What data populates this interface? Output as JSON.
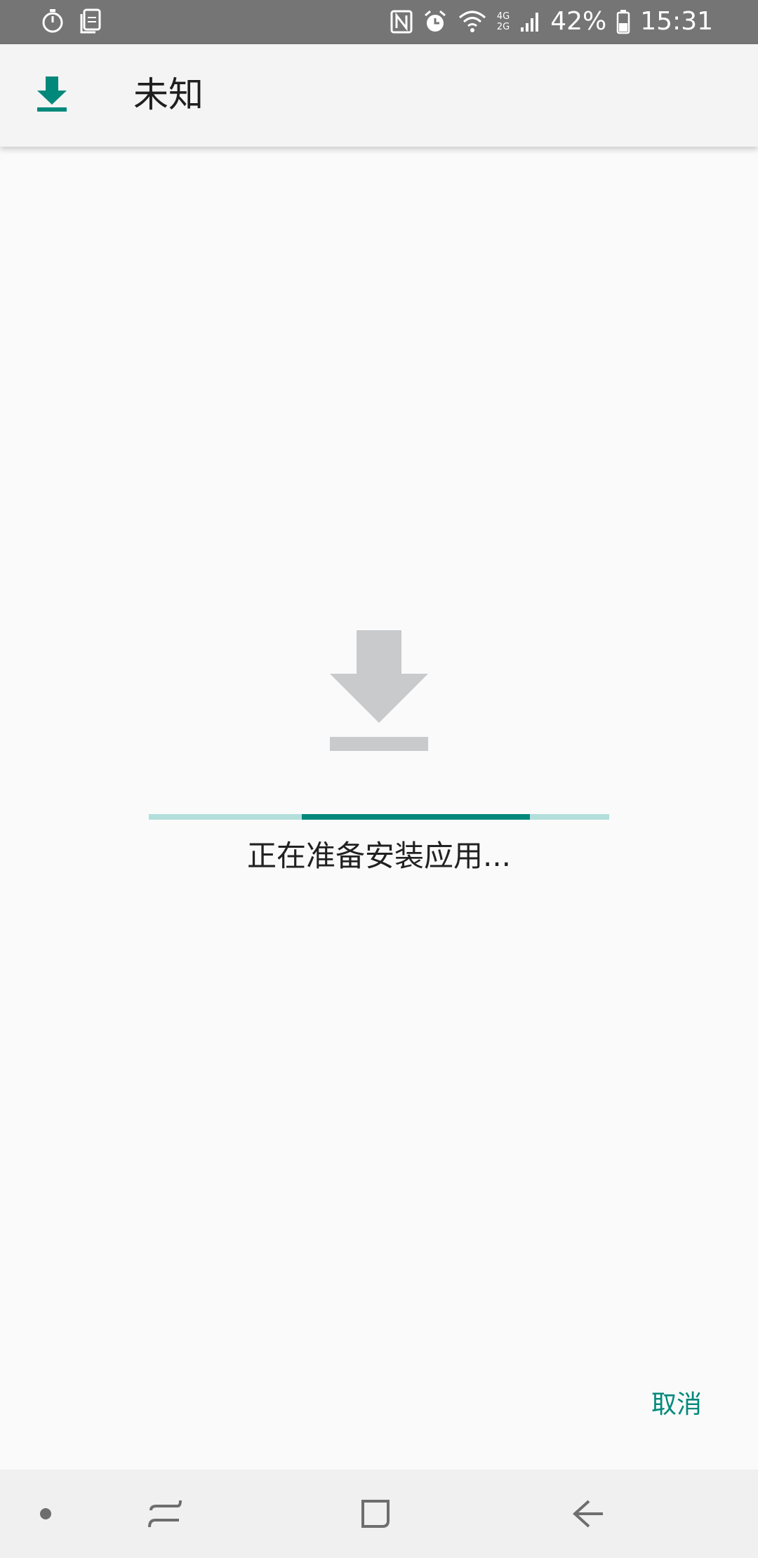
{
  "status_bar": {
    "battery": "42%",
    "time": "15:31",
    "network_labels": [
      "4G",
      "2G"
    ],
    "icons": [
      "stopwatch-icon",
      "clipboard-icon",
      "nfc-icon",
      "alarm-icon",
      "wifi-icon",
      "cell-signal-icon",
      "battery-icon"
    ]
  },
  "app_bar": {
    "title": "未知",
    "icon": "download-icon"
  },
  "install": {
    "message": "正在准备安装应用...",
    "progress_indeterminate": true,
    "progress_visible_segment": [
      0.333,
      0.827
    ],
    "cancel_label": "取消"
  },
  "nav_bar": {
    "items": [
      "dot-indicator-icon",
      "recents-icon",
      "home-icon",
      "back-icon"
    ]
  },
  "colors": {
    "accent": "#00897b",
    "progress_track": "#b2dfdb",
    "status_bar_bg": "#757575",
    "app_bar_bg": "#f4f4f4",
    "background": "#fafafa",
    "placeholder_icon": "#c8cacc"
  }
}
